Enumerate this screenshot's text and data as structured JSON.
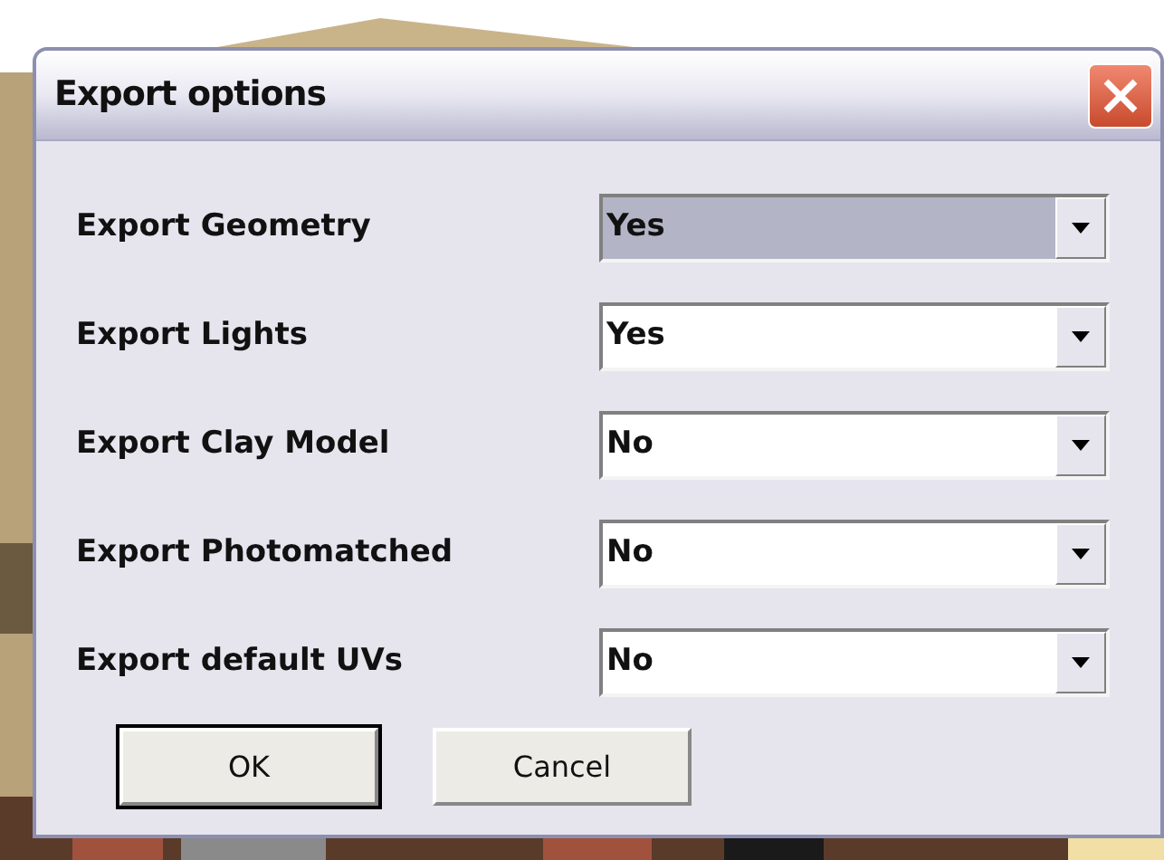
{
  "window": {
    "title": "Export options"
  },
  "options": [
    {
      "label": "Export Geometry",
      "value": "Yes",
      "focused": true
    },
    {
      "label": "Export Lights",
      "value": "Yes",
      "focused": false
    },
    {
      "label": "Export Clay Model",
      "value": "No",
      "focused": false
    },
    {
      "label": "Export Photomatched",
      "value": "No",
      "focused": false
    },
    {
      "label": "Export default UVs",
      "value": "No",
      "focused": false
    }
  ],
  "buttons": [
    {
      "label": "OK",
      "default": true
    },
    {
      "label": "Cancel",
      "default": false
    }
  ]
}
